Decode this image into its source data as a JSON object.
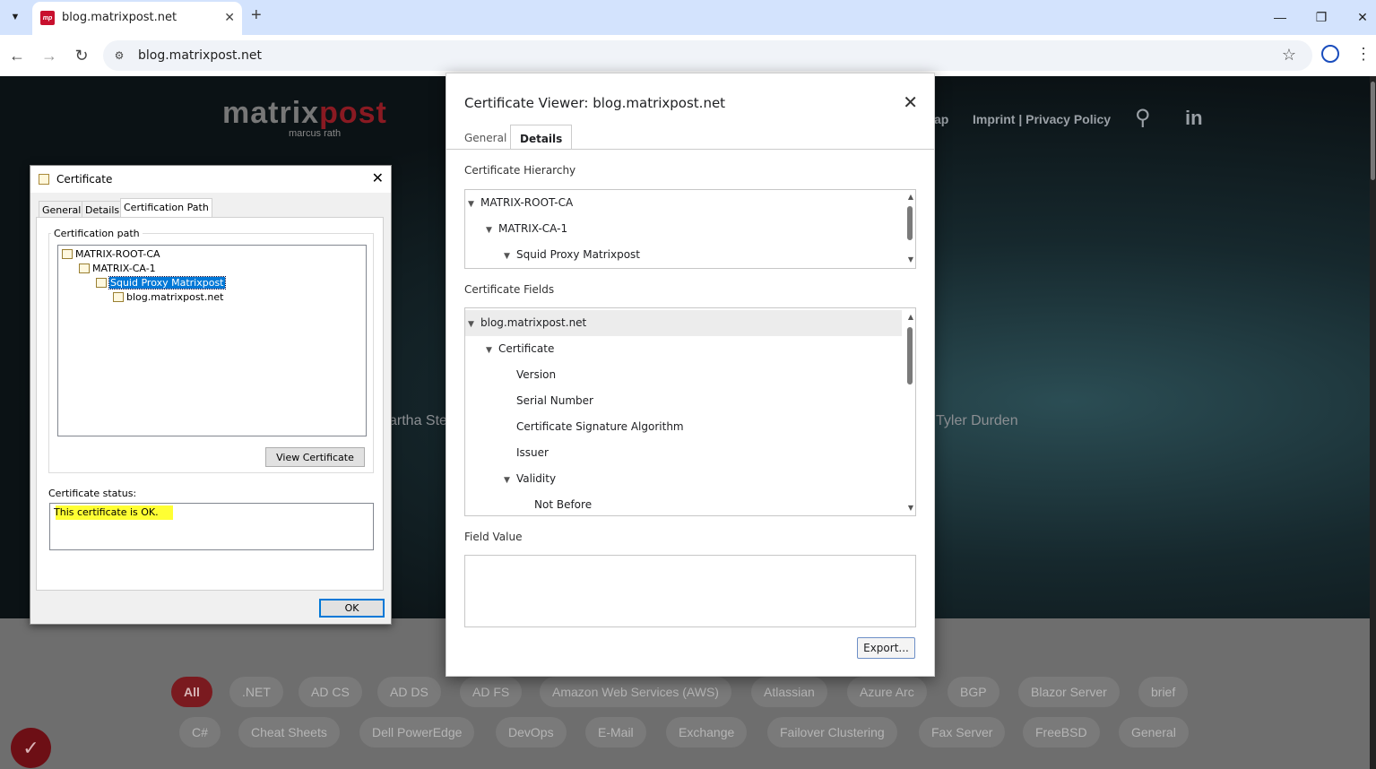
{
  "browser": {
    "tab_title": "blog.matrixpost.net",
    "favicon_text": "mp",
    "url": "blog.matrixpost.net"
  },
  "site": {
    "logo_main": "matrix",
    "logo_accent": "post",
    "logo_sub": "marcus rath",
    "nav_fragment": "ap",
    "nav_imprint": "Imprint | Privacy Policy",
    "hero_left_text": "artha Ste",
    "hero_right_text": "Tyler Durden",
    "tags_row1": [
      "All",
      ".NET",
      "AD CS",
      "AD DS",
      "AD FS",
      "Amazon Web Services (AWS)",
      "Atlassian",
      "Azure Arc",
      "BGP",
      "Blazor Server",
      "brief"
    ],
    "tags_row2": [
      "C#",
      "Cheat Sheets",
      "Dell PowerEdge",
      "DevOps",
      "E-Mail",
      "Exchange",
      "Failover Clustering",
      "Fax Server",
      "FreeBSD",
      "General"
    ]
  },
  "win_cert": {
    "title": "Certificate",
    "tabs": [
      "General",
      "Details",
      "Certification Path"
    ],
    "path_legend": "Certification path",
    "path": [
      "MATRIX-ROOT-CA",
      "MATRIX-CA-1",
      "Squid Proxy Matrixpost",
      "blog.matrixpost.net"
    ],
    "view_button": "View Certificate",
    "status_label": "Certificate status:",
    "status_text": "This certificate is OK.",
    "ok_button": "OK"
  },
  "cert_viewer": {
    "title": "Certificate Viewer: blog.matrixpost.net",
    "tabs": [
      "General",
      "Details"
    ],
    "hierarchy_label": "Certificate Hierarchy",
    "hierarchy": [
      "MATRIX-ROOT-CA",
      "MATRIX-CA-1",
      "Squid Proxy Matrixpost"
    ],
    "fields_label": "Certificate Fields",
    "fields": [
      "blog.matrixpost.net",
      "Certificate",
      "Version",
      "Serial Number",
      "Certificate Signature Algorithm",
      "Issuer",
      "Validity",
      "Not Before"
    ],
    "field_value_label": "Field Value",
    "export_button": "Export..."
  }
}
